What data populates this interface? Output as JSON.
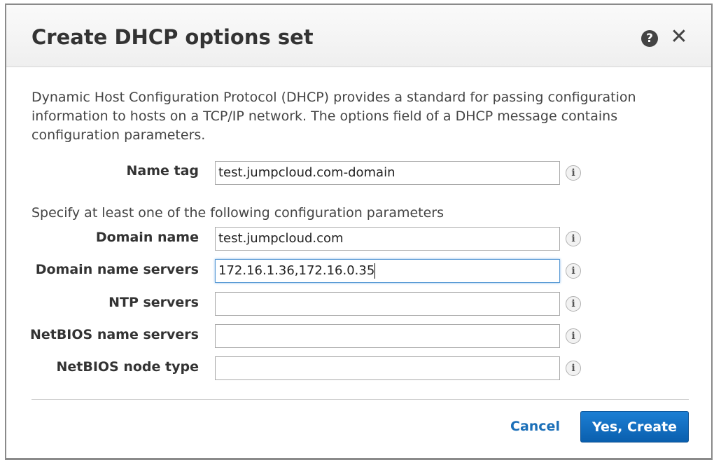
{
  "dialog": {
    "title": "Create DHCP options set",
    "help_icon": "help-icon",
    "close_icon": "close-icon",
    "close_glyph": "✕",
    "help_glyph": "?",
    "description": "Dynamic Host Configuration Protocol (DHCP) provides a standard for passing configuration information to hosts on a TCP/IP network. The options field of a DHCP message contains configuration parameters."
  },
  "name_tag": {
    "label": "Name tag",
    "value": "test.jumpcloud.com-domain"
  },
  "config": {
    "subheading": "Specify at least one of the following configuration parameters",
    "fields": [
      {
        "label": "Domain name",
        "value": "test.jumpcloud.com"
      },
      {
        "label": "Domain name servers",
        "value": "172.16.1.36,172.16.0.35"
      },
      {
        "label": "NTP servers",
        "value": ""
      },
      {
        "label": "NetBIOS name servers",
        "value": ""
      },
      {
        "label": "NetBIOS node type",
        "value": ""
      }
    ]
  },
  "info_glyph": "i",
  "footer": {
    "cancel_label": "Cancel",
    "create_label": "Yes, Create"
  },
  "colors": {
    "primary": "#0a5fae",
    "link": "#1b6fb8",
    "focus": "#5b9bd5"
  }
}
